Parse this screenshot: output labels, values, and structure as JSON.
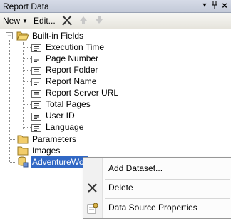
{
  "window": {
    "title": "Report Data"
  },
  "title_buttons": {
    "dropdown": "▾",
    "pin": "📌",
    "close": "×"
  },
  "toolbar": {
    "new_label": "New",
    "edit_label": "Edit..."
  },
  "tree": {
    "builtin": {
      "label": "Built-in Fields",
      "expanded": "−"
    },
    "fields": [
      "Execution Time",
      "Page Number",
      "Report Folder",
      "Report Name",
      "Report Server URL",
      "Total Pages",
      "User ID",
      "Language"
    ],
    "parameters": "Parameters",
    "images": "Images",
    "datasource": "AdventureWor"
  },
  "context_menu": {
    "items": [
      "Add Dataset...",
      "Delete",
      "Data Source Properties"
    ]
  },
  "colors": {
    "selection": "#3168c5",
    "folder": "#f2cc6a"
  }
}
